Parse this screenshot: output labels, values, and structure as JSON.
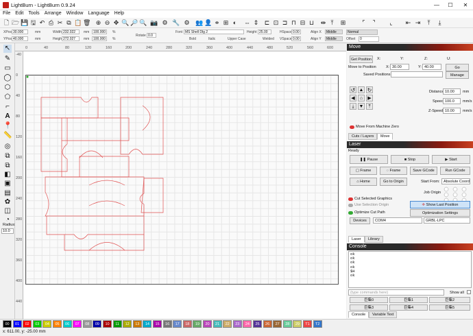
{
  "window": {
    "title": "LightBurn - LightBurn 0.9.24",
    "minimize": "—",
    "maximize": "☐",
    "close": "✕"
  },
  "menu": [
    "File",
    "Edit",
    "Tools",
    "Arrange",
    "Window",
    "Language",
    "Help"
  ],
  "toolbar2": {
    "xpos_label": "XPos",
    "xpos_value": "30.000",
    "ypos_label": "YPos",
    "ypos_value": "40.000",
    "width_label": "Width",
    "width_value": "232.022",
    "height_label": "Height",
    "height_value": "272.027",
    "unit_mm": "mm",
    "scale_x": "100.000",
    "scale_y": "100.000",
    "pct": "%",
    "rotate_label": "Rotate",
    "rotate_value": "0.0",
    "font_label": "Font",
    "font_value": "MS Shell Dlg 2",
    "fheight_label": "Height",
    "fheight_value": "25.00",
    "hspace_label": "HSpace",
    "hspace_value": "0.00",
    "vspace_label": "VSpace",
    "vspace_value": "0.00",
    "alignx_label": "Align X",
    "alignx_value": "Middle",
    "aligny_label": "Align Y",
    "aligny_value": "Middle",
    "normal": "Normal",
    "offset_label": "Offset",
    "offset_value": "0",
    "bold": "Bold",
    "italic": "Italic",
    "upper": "Upper Case",
    "welded": "Welded"
  },
  "ruler": {
    "top": [
      "0",
      "20",
      "40",
      "60",
      "80",
      "100",
      "120",
      "140",
      "160",
      "180",
      "200",
      "220",
      "240",
      "260",
      "280",
      "300",
      "320",
      "340",
      "360",
      "380",
      "400",
      "420",
      "440",
      "460",
      "480",
      "500",
      "520",
      "540",
      "560",
      "580",
      "600"
    ],
    "top_major": [
      "0",
      "40",
      "80",
      "120",
      "160",
      "200",
      "240",
      "280",
      "320",
      "360",
      "400",
      "440",
      "480",
      "520",
      "560",
      "600"
    ],
    "left_major": [
      "-40",
      "0",
      "40",
      "80",
      "120",
      "160",
      "200",
      "240",
      "280",
      "320",
      "360",
      "400",
      "440"
    ]
  },
  "move_panel": {
    "title": "Move",
    "get_position": "Get Position",
    "x_label": "X:",
    "y_label": "Y:",
    "z_label": "Z:",
    "u_label": "U:",
    "move_to_position": "Move to Position",
    "mx_label": "X:",
    "mx_value": "30.00",
    "my_label": "Y:",
    "my_value": "40.00",
    "go": "Go",
    "saved_positions": "Saved Positions:",
    "manage": "Manage",
    "distance_label": "Distance",
    "distance_value": "10.00",
    "distance_unit": "mm",
    "speed_label": "Speed",
    "speed_value": "100.0",
    "speed_unit": "mm/s",
    "zspeed_label": "Z-Speed",
    "zspeed_value": "10.00",
    "zspeed_unit": "mm/s",
    "move_from_zero": "Move From Machine Zero",
    "tabs": [
      "Cuts / Layers",
      "Move"
    ]
  },
  "laser_panel": {
    "title": "Laser",
    "status": "Ready",
    "pause": "Pause",
    "stop": "Stop",
    "start": "Start",
    "frame1": "Frame",
    "frame2": "Frame",
    "save_gcode": "Save GCode",
    "run_gcode": "Run GCode",
    "home": "Home",
    "go_to_origin": "Go to Origin",
    "start_from_label": "Start From:",
    "start_from_value": "Absolute Coords",
    "job_origin": "Job Origin",
    "cut_selected": "Cut Selected Graphics",
    "use_selection_origin": "Use Selection Origin",
    "optimize_cut": "Optimize Cut Path",
    "show_last_position": "Show Last Position",
    "optimization_settings": "Optimization Settings",
    "devices": "Devices",
    "port": "COM4",
    "device": "GRBL-LPC",
    "tabs": [
      "Laser",
      "Library"
    ]
  },
  "console_panel": {
    "title": "Console",
    "lines": [
      "ok",
      "ok",
      "ok",
      "ok",
      "$H",
      "ok"
    ],
    "input_placeholder": "(type commands here)",
    "show_all": "Show all",
    "macros": [
      "巨集0",
      "巨集1",
      "巨集2",
      "巨集3",
      "巨集4",
      "巨集5"
    ],
    "tabs": [
      "Console",
      "Variable Text"
    ]
  },
  "palette": [
    {
      "label": "00",
      "color": "#000000"
    },
    {
      "label": "01",
      "color": "#0000ff"
    },
    {
      "label": "02",
      "color": "#ff0000"
    },
    {
      "label": "03",
      "color": "#00cc00"
    },
    {
      "label": "04",
      "color": "#cccc00"
    },
    {
      "label": "05",
      "color": "#ff8000"
    },
    {
      "label": "06",
      "color": "#00cccc"
    },
    {
      "label": "07",
      "color": "#ff00ff"
    },
    {
      "label": "08",
      "color": "#999999"
    },
    {
      "label": "09",
      "color": "#0000aa"
    },
    {
      "label": "10",
      "color": "#aa0000"
    },
    {
      "label": "11",
      "color": "#009900"
    },
    {
      "label": "12",
      "color": "#aaaa00"
    },
    {
      "label": "13",
      "color": "#cc7700"
    },
    {
      "label": "14",
      "color": "#00aacc"
    },
    {
      "label": "15",
      "color": "#aa00aa"
    },
    {
      "label": "16",
      "color": "#777777"
    },
    {
      "label": "17",
      "color": "#6688cc"
    },
    {
      "label": "18",
      "color": "#cc6666"
    },
    {
      "label": "19",
      "color": "#66aa66"
    },
    {
      "label": "20",
      "color": "#bb44bb"
    },
    {
      "label": "21",
      "color": "#44bbbb"
    },
    {
      "label": "22",
      "color": "#ccaa66"
    },
    {
      "label": "23",
      "color": "#aa66cc"
    },
    {
      "label": "24",
      "color": "#ff66aa"
    },
    {
      "label": "25",
      "color": "#553399"
    },
    {
      "label": "26",
      "color": "#cc6633"
    },
    {
      "label": "27",
      "color": "#996633"
    },
    {
      "label": "28",
      "color": "#66cc99"
    },
    {
      "label": "29",
      "color": "#cccc66"
    },
    {
      "label": "T1",
      "color": "#ee4444"
    },
    {
      "label": "T2",
      "color": "#3377cc"
    }
  ],
  "status": "x: 611.00, y: -25.00 mm",
  "left_tools": {
    "radius_label": "Radius:",
    "radius_value": "10.0"
  },
  "colors": {
    "accent": "#c84020",
    "shape_stroke": "#e05050",
    "grid": "#e6e6e6"
  }
}
